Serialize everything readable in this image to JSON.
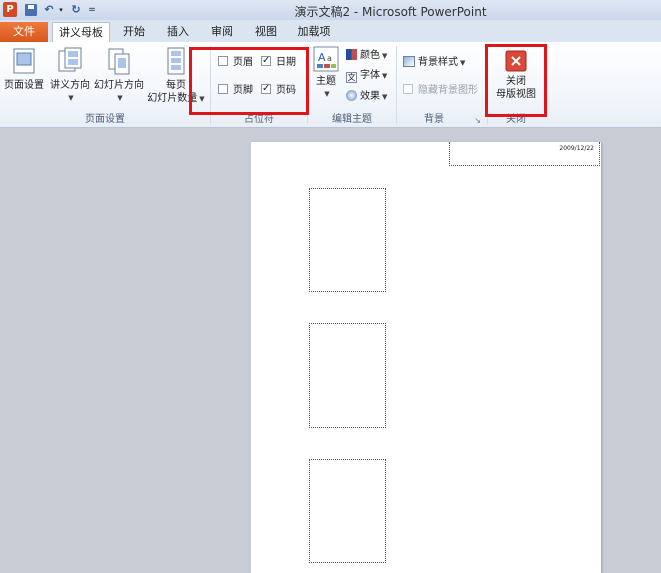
{
  "titlebar": {
    "app_icon_letter": "P",
    "title": "演示文稿2 - Microsoft PowerPoint",
    "qat_dropdown_glyph": "▾",
    "qat_customize_glyph": "="
  },
  "tabs": [
    {
      "label": "文件"
    },
    {
      "label": "讲义母板"
    },
    {
      "label": "开始"
    },
    {
      "label": "插入"
    },
    {
      "label": "审阅"
    },
    {
      "label": "视图"
    },
    {
      "label": "加载项"
    }
  ],
  "ribbon": {
    "page_setup_group": {
      "label": "页面设置",
      "page_setup": "页面设置",
      "handout_orientation": "讲义方向",
      "slide_orientation": "幻灯片方向",
      "slides_per_page_line1": "每页",
      "slides_per_page_line2": "幻灯片数量"
    },
    "placeholders_group": {
      "label": "占位符",
      "header": {
        "label": "页眉",
        "checked": false
      },
      "date": {
        "label": "日期",
        "checked": true
      },
      "footer": {
        "label": "页脚",
        "checked": false
      },
      "page_number": {
        "label": "页码",
        "checked": true
      }
    },
    "edit_theme_group": {
      "label": "编辑主题",
      "themes": "主题",
      "colors": "颜色",
      "fonts": "字体",
      "effects": "效果"
    },
    "background_group": {
      "label": "背景",
      "background_styles": "背景样式",
      "hide_background_graphics": "隐藏背景图形",
      "launcher_glyph": "↘"
    },
    "close_group": {
      "label": "关闭",
      "close_line1": "关闭",
      "close_line2": "母版视图"
    }
  },
  "document": {
    "date_text": "2009/12/22",
    "slide_placeholder_count": 3
  },
  "colors": {
    "file_tab": "#d9561c",
    "highlight": "#e0151b",
    "workspace": "#c7ccd5"
  }
}
